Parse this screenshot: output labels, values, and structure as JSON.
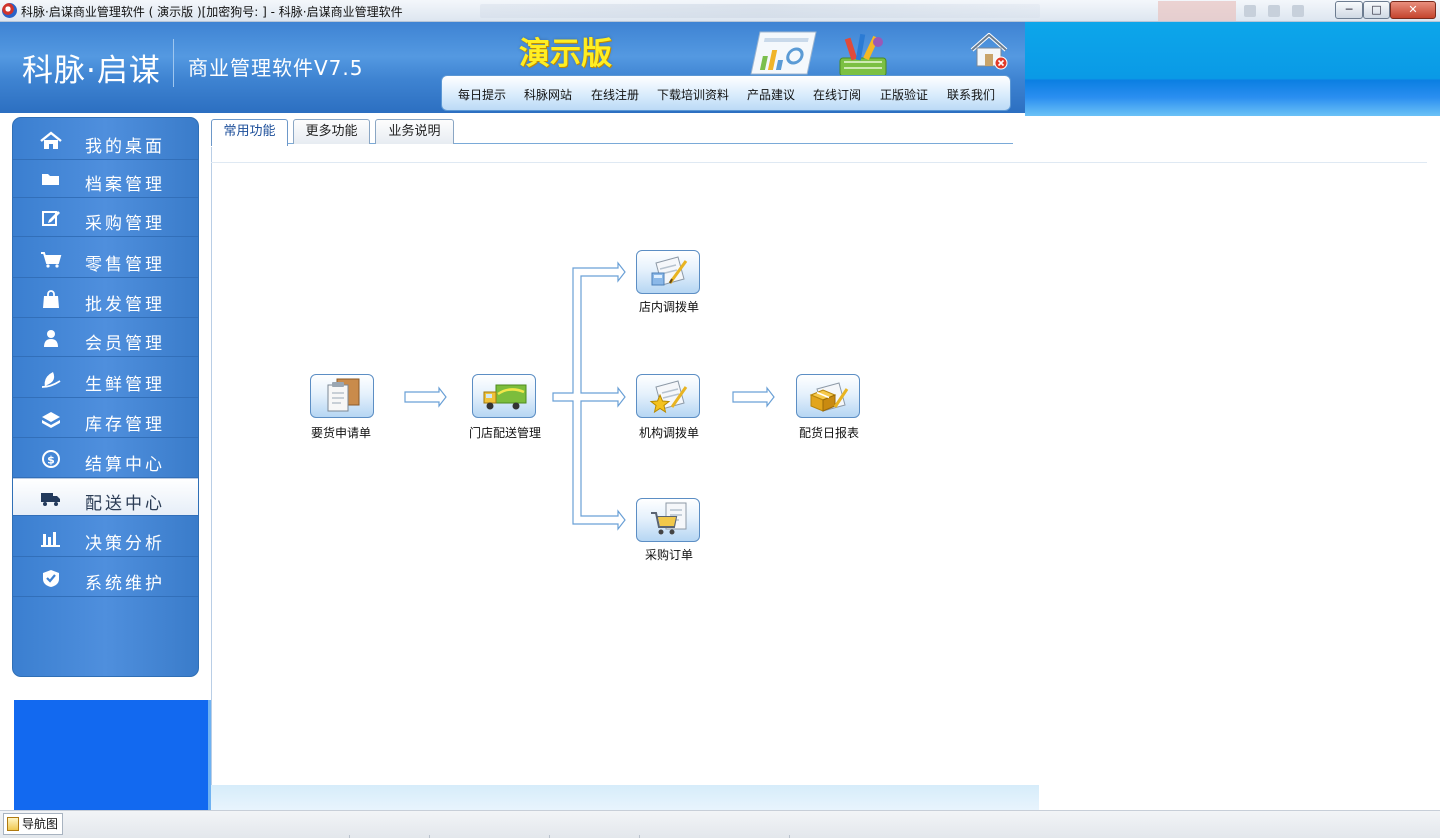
{
  "window": {
    "title": "科脉·启谋商业管理软件 ( 演示版 )[加密狗号: ] - 科脉·启谋商业管理软件",
    "min_glyph": "─",
    "max_glyph": "□",
    "close_glyph": "✕"
  },
  "header": {
    "brand": "科脉·启谋",
    "product": "商业管理软件V7.5",
    "demo_badge": "演示版",
    "nav": [
      "每日提示",
      "科脉网站",
      "在线注册",
      "下载培训资料",
      "产品建议",
      "在线订阅",
      "正版验证",
      "联系我们"
    ]
  },
  "sidebar": {
    "items": [
      {
        "label": "我的桌面",
        "icon": "home-icon"
      },
      {
        "label": "档案管理",
        "icon": "folder-icon"
      },
      {
        "label": "采购管理",
        "icon": "edit-icon"
      },
      {
        "label": "零售管理",
        "icon": "cart-icon"
      },
      {
        "label": "批发管理",
        "icon": "bag-icon"
      },
      {
        "label": "会员管理",
        "icon": "user-icon"
      },
      {
        "label": "生鲜管理",
        "icon": "leaf-icon"
      },
      {
        "label": "库存管理",
        "icon": "box-icon"
      },
      {
        "label": "结算中心",
        "icon": "dollar-icon"
      },
      {
        "label": "配送中心",
        "icon": "truck-icon",
        "active": true
      },
      {
        "label": "决策分析",
        "icon": "bar-chart-icon"
      },
      {
        "label": "系统维护",
        "icon": "shield-icon"
      }
    ]
  },
  "tabs": [
    {
      "label": "常用功能",
      "active": true
    },
    {
      "label": "更多功能",
      "active": false
    },
    {
      "label": "业务说明",
      "active": false
    }
  ],
  "flow": {
    "nodes": {
      "request": {
        "label": "要货申请单",
        "icon": "clipboard-icon"
      },
      "store_delivery": {
        "label": "门店配送管理",
        "icon": "delivery-truck-icon"
      },
      "instore_transfer": {
        "label": "店内调拨单",
        "icon": "transfer-form-icon"
      },
      "org_transfer": {
        "label": "机构调拨单",
        "icon": "star-form-icon"
      },
      "purchase_order": {
        "label": "采购订单",
        "icon": "shopping-cart-form-icon"
      },
      "daily_report": {
        "label": "配货日报表",
        "icon": "package-report-icon"
      }
    }
  },
  "statusbar": {
    "tab_label": "导航图"
  },
  "colors": {
    "header_blue": "#3f84d2",
    "sidebar_blue": "#4585d5",
    "demo_yellow": "#ffee22",
    "accent_cyan": "#0a9ae6"
  }
}
